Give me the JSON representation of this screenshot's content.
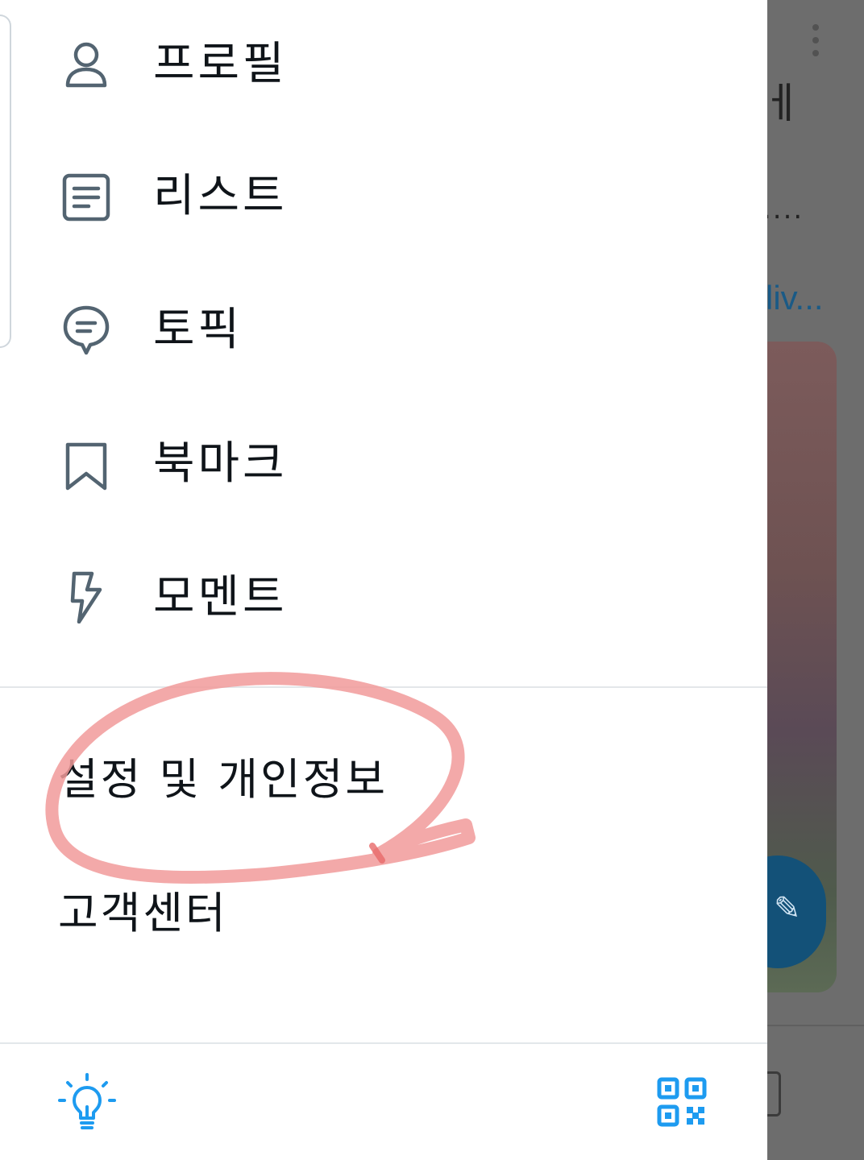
{
  "background": {
    "title_fragment": "ㅔ",
    "text_fragment": "....",
    "link_fragment": "liv...",
    "fab_icon": "feather-icon"
  },
  "drawer": {
    "menu": [
      {
        "label": "프로필",
        "icon": "user-icon"
      },
      {
        "label": "리스트",
        "icon": "list-icon"
      },
      {
        "label": "토픽",
        "icon": "topic-bubble-icon"
      },
      {
        "label": "북마크",
        "icon": "bookmark-icon"
      },
      {
        "label": "모멘트",
        "icon": "lightning-icon"
      }
    ],
    "settings_label": "설정 및 개인정보",
    "help_label": "고객센터",
    "footer": {
      "left_icon": "lightbulb-icon",
      "right_icon": "qr-code-icon"
    }
  },
  "colors": {
    "accent": "#1d9bf0",
    "icon_gray": "#536471",
    "annotation": "#f19a9a"
  }
}
